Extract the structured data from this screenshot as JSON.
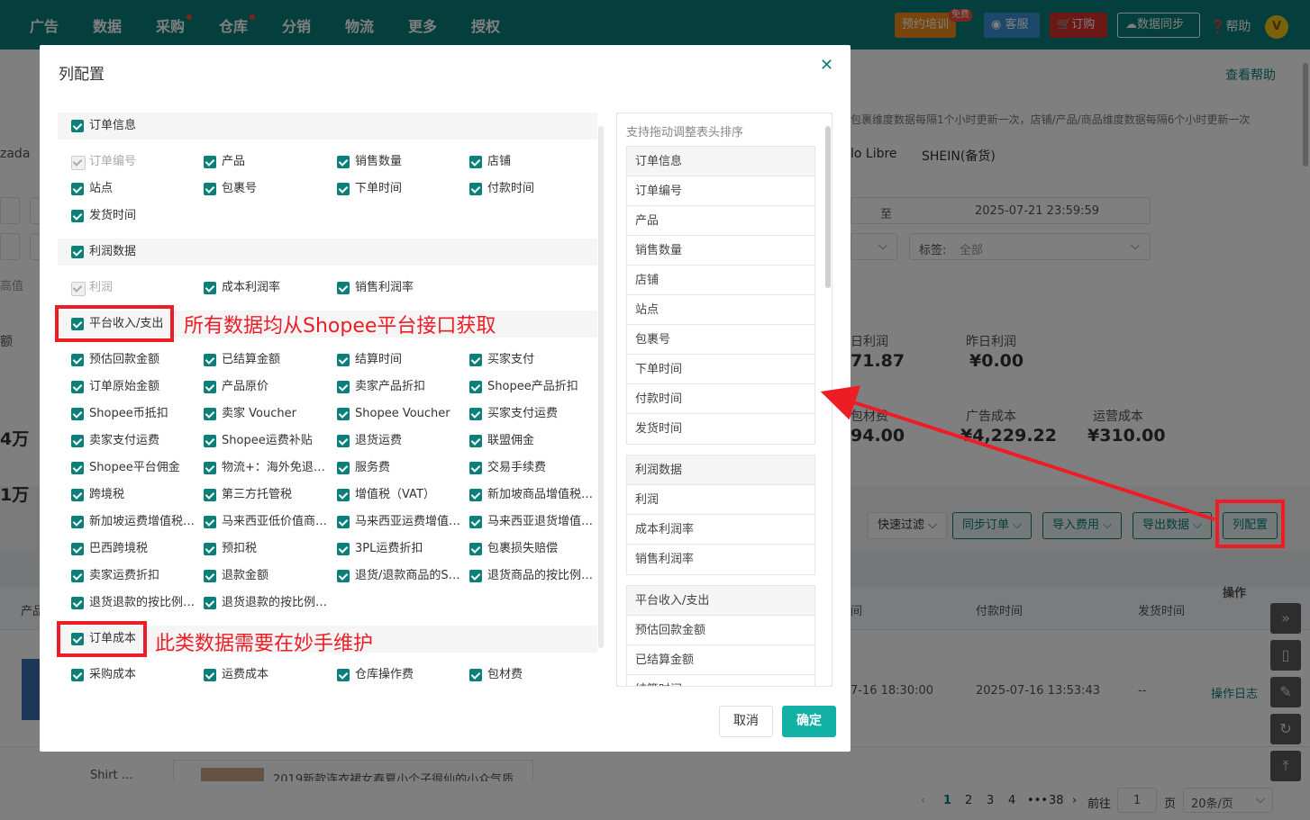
{
  "nav": {
    "items": [
      "广告",
      "数据",
      "采购",
      "仓库",
      "分销",
      "物流",
      "更多",
      "授权"
    ],
    "training_label": "预约培训",
    "free_badge": "免费",
    "service_label": "客服",
    "order_label": "订购",
    "sync_label": "数据同步",
    "help_label": "帮助",
    "avatar_letter": "V"
  },
  "background": {
    "view_help": "查看帮助",
    "update_note": "包裹维度数据每隔1个小时更新一次，店铺/产品/商品维度数据每隔6个小时更新一次",
    "platform_zada": "zada",
    "platform_mercado": "lo Libre",
    "platform_shein": "SHEIN(备货)",
    "date_to": "至",
    "date_end": "2025-07-21 23:59:59",
    "tag_label": "标签:",
    "tag_value": "全部",
    "high_value": "高值",
    "stats": [
      {
        "label": "日利润",
        "value": "71.87"
      },
      {
        "label": "昨日利润",
        "value": "¥0.00"
      },
      {
        "label": "包材费",
        "value": "94.00"
      },
      {
        "label": "广告成本",
        "value": "¥4,229.22"
      },
      {
        "label": "运营成本",
        "value": "¥310.00"
      }
    ],
    "left_fragments": [
      "额",
      "4万",
      "1万"
    ],
    "buttons": [
      "快速过滤",
      "同步订单",
      "导入费用",
      "导出数据",
      "列配置"
    ],
    "table_headers": [
      "产品",
      "间",
      "付款时间",
      "发货时间",
      "操作"
    ],
    "row": {
      "time1": "7-16 18:30:00",
      "time2": "2025-07-16 13:53:43",
      "ship": "--",
      "action": "操作日志"
    },
    "row2_title": "2019新款连衣裙女春夏小个子很仙的小众气质…",
    "row2_left": "Shirt …",
    "pager": {
      "pages": [
        "1",
        "2",
        "3",
        "4",
        "•••",
        "38"
      ],
      "goto": "前往",
      "page_input": "1",
      "page_unit": "页",
      "per_page": "20条/页"
    }
  },
  "modal": {
    "title": "列配置",
    "right_hint": "支持拖动调整表头排序",
    "cancel": "取消",
    "ok": "确定",
    "groups": [
      {
        "name": "订单信息",
        "items": [
          {
            "label": "订单编号",
            "disabled": true
          },
          {
            "label": "产品"
          },
          {
            "label": "销售数量"
          },
          {
            "label": "店铺"
          },
          {
            "label": "站点"
          },
          {
            "label": "包裹号"
          },
          {
            "label": "下单时间"
          },
          {
            "label": "付款时间"
          },
          {
            "label": "发货时间"
          }
        ]
      },
      {
        "name": "利润数据",
        "items": [
          {
            "label": "利润",
            "disabled": true
          },
          {
            "label": "成本利润率"
          },
          {
            "label": "销售利润率"
          }
        ]
      },
      {
        "name": "平台收入/支出",
        "items": [
          {
            "label": "预估回款金额"
          },
          {
            "label": "已结算金额"
          },
          {
            "label": "结算时间"
          },
          {
            "label": "买家支付"
          },
          {
            "label": "订单原始金额"
          },
          {
            "label": "产品原价"
          },
          {
            "label": "卖家产品折扣"
          },
          {
            "label": "Shopee产品折扣"
          },
          {
            "label": "Shopee币抵扣"
          },
          {
            "label": "卖家 Voucher"
          },
          {
            "label": "Shopee Voucher"
          },
          {
            "label": "买家支付运费"
          },
          {
            "label": "卖家支付运费"
          },
          {
            "label": "Shopee运费补贴"
          },
          {
            "label": "退货运费"
          },
          {
            "label": "联盟佣金"
          },
          {
            "label": "Shopee平台佣金"
          },
          {
            "label": "物流+：海外免退…"
          },
          {
            "label": "服务费"
          },
          {
            "label": "交易手续费"
          },
          {
            "label": "跨境税"
          },
          {
            "label": "第三方托管税"
          },
          {
            "label": "增值税（VAT）"
          },
          {
            "label": "新加坡商品增值税…"
          },
          {
            "label": "新加坡运费增值税…"
          },
          {
            "label": "马来西亚低价值商…"
          },
          {
            "label": "马来西亚运费增值…"
          },
          {
            "label": "马来西亚退货增值…"
          },
          {
            "label": "巴西跨境税"
          },
          {
            "label": "预扣税"
          },
          {
            "label": "3PL运费折扣"
          },
          {
            "label": "包裹损失赔偿"
          },
          {
            "label": "卖家运费折扣"
          },
          {
            "label": "退款金额"
          },
          {
            "label": "退货/退款商品的S…"
          },
          {
            "label": "退货商品的按比例…"
          },
          {
            "label": "退货退款的按比例…"
          },
          {
            "label": "退货退款的按比例…"
          }
        ]
      },
      {
        "name": "订单成本",
        "items": [
          {
            "label": "采购成本"
          },
          {
            "label": "运费成本"
          },
          {
            "label": "仓库操作费"
          },
          {
            "label": "包材费"
          }
        ]
      }
    ],
    "sort_groups": [
      [
        "订单信息",
        "订单编号",
        "产品",
        "销售数量",
        "店铺",
        "站点",
        "包裹号",
        "下单时间",
        "付款时间",
        "发货时间"
      ],
      [
        "利润数据",
        "利润",
        "成本利润率",
        "销售利润率"
      ],
      [
        "平台收入/支出",
        "预估回款金额",
        "已结算金额",
        "结算时间"
      ]
    ]
  },
  "annotations": {
    "note1": "所有数据均从Shopee平台接口获取",
    "note2": "此类数据需要在妙手维护"
  },
  "colors": {
    "brand": "#0b7f7a",
    "ok_button": "#13b0a5",
    "annotation": "#ee1c25"
  }
}
